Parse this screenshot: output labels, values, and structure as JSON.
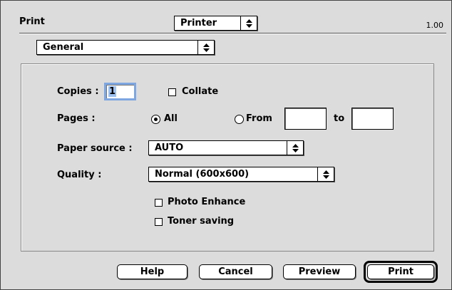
{
  "dialog": {
    "title": "Print",
    "version": "1.00",
    "printer_popup": "Printer",
    "panel_popup": "General"
  },
  "copies": {
    "label": "Copies :",
    "value": "1"
  },
  "collate": {
    "label": "Collate",
    "checked": false
  },
  "pages": {
    "label": "Pages :",
    "all_label": "All",
    "from_label": "From",
    "to_label": "to",
    "selected": "All",
    "from_value": "",
    "to_value": ""
  },
  "paper_source": {
    "label": "Paper source :",
    "value": "AUTO"
  },
  "quality": {
    "label": "Quality :",
    "value": "Normal (600x600)"
  },
  "options": {
    "photo_enhance": {
      "label": "Photo Enhance",
      "checked": false
    },
    "toner_saving": {
      "label": "Toner saving",
      "checked": false
    }
  },
  "buttons": {
    "help": "Help",
    "cancel": "Cancel",
    "preview": "Preview",
    "print": "Print"
  }
}
